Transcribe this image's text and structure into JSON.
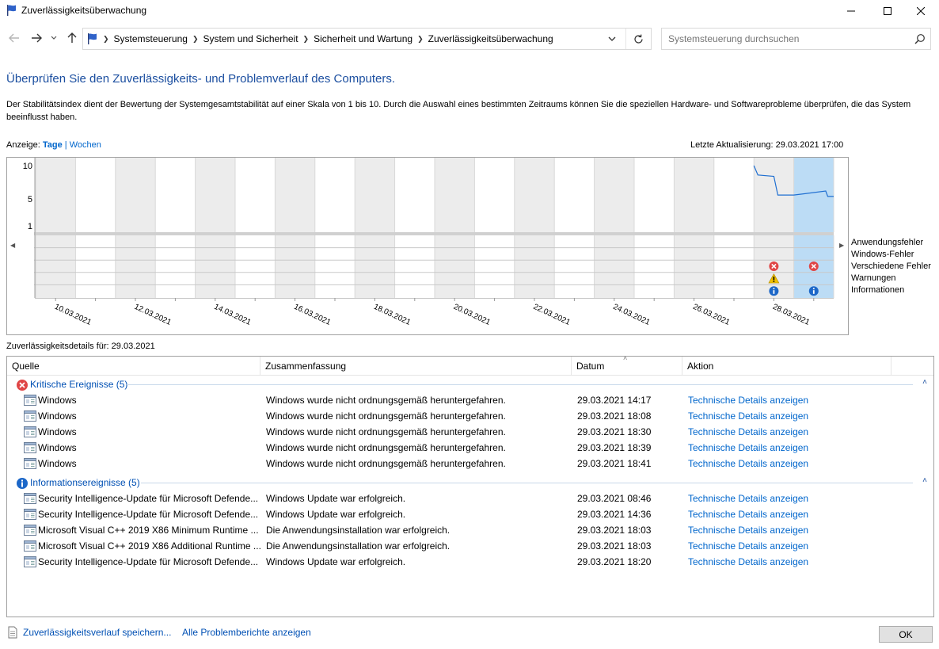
{
  "window": {
    "title": "Zuverlässigkeitsüberwachung"
  },
  "address": {
    "crumbs": [
      "Systemsteuerung",
      "System und Sicherheit",
      "Sicherheit und Wartung",
      "Zuverlässigkeitsüberwachung"
    ],
    "search_placeholder": "Systemsteuerung durchsuchen"
  },
  "header": {
    "title": "Überprüfen Sie den Zuverlässigkeits- und Problemverlauf des Computers.",
    "description": "Der Stabilitätsindex dient der Bewertung der Systemgesamtstabilität auf einer Skala von 1 bis 10. Durch die Auswahl eines bestimmten Zeitraums können Sie die speziellen Hardware- und Softwareprobleme überprüfen, die das System beeinflusst haben."
  },
  "view": {
    "label": "Anzeige:",
    "option_days": "Tage",
    "separator": "|",
    "option_weeks": "Wochen"
  },
  "last_update": "Letzte Aktualisierung: 29.03.2021 17:00",
  "chart_data": {
    "type": "line",
    "y_ticks": [
      "10",
      "5",
      "1"
    ],
    "ylim": [
      1,
      10
    ],
    "date_labels": [
      "10.03.2021",
      "12.03.2021",
      "14.03.2021",
      "16.03.2021",
      "18.03.2021",
      "20.03.2021",
      "22.03.2021",
      "24.03.2021",
      "26.03.2021",
      "28.03.2021"
    ],
    "column_count": 20,
    "selected_column": 19,
    "stability_series": [
      {
        "col": 18.0,
        "value": 10.0
      },
      {
        "col": 18.1,
        "value": 8.6
      },
      {
        "col": 18.5,
        "value": 8.4
      },
      {
        "col": 18.6,
        "value": 5.6
      },
      {
        "col": 19.0,
        "value": 5.6
      },
      {
        "col": 19.8,
        "value": 6.2
      },
      {
        "col": 19.85,
        "value": 5.4
      },
      {
        "col": 20.0,
        "value": 5.4
      }
    ],
    "event_rows": [
      "Anwendungsfehler",
      "Windows-Fehler",
      "Verschiedene Fehler",
      "Warnungen",
      "Informationen"
    ],
    "events": [
      {
        "col": 18,
        "row": 2,
        "kind": "error"
      },
      {
        "col": 18,
        "row": 3,
        "kind": "warning"
      },
      {
        "col": 18,
        "row": 4,
        "kind": "info"
      },
      {
        "col": 19,
        "row": 2,
        "kind": "error"
      },
      {
        "col": 19,
        "row": 4,
        "kind": "info"
      }
    ],
    "colors": {
      "line": "#1f6fd1",
      "selected": "#bcdcf5",
      "shaded": "#ececec",
      "error": "#e04646",
      "warning": "#f2c200",
      "info": "#1c67c8"
    }
  },
  "details": {
    "label": "Zuverlässigkeitsdetails für: 29.03.2021",
    "columns": [
      "Quelle",
      "Zusammenfassung",
      "Datum",
      "Aktion"
    ],
    "groups": [
      {
        "label": "Kritische Ereignisse (5)",
        "icon": "error-icon",
        "rows": [
          {
            "source": "Windows",
            "summary": "Windows wurde nicht ordnungsgemäß heruntergefahren.",
            "date": "29.03.2021 14:17",
            "action": "Technische Details anzeigen"
          },
          {
            "source": "Windows",
            "summary": "Windows wurde nicht ordnungsgemäß heruntergefahren.",
            "date": "29.03.2021 18:08",
            "action": "Technische Details anzeigen"
          },
          {
            "source": "Windows",
            "summary": "Windows wurde nicht ordnungsgemäß heruntergefahren.",
            "date": "29.03.2021 18:30",
            "action": "Technische Details anzeigen"
          },
          {
            "source": "Windows",
            "summary": "Windows wurde nicht ordnungsgemäß heruntergefahren.",
            "date": "29.03.2021 18:39",
            "action": "Technische Details anzeigen"
          },
          {
            "source": "Windows",
            "summary": "Windows wurde nicht ordnungsgemäß heruntergefahren.",
            "date": "29.03.2021 18:41",
            "action": "Technische Details anzeigen"
          }
        ]
      },
      {
        "label": "Informationsereignisse (5)",
        "icon": "info-icon",
        "rows": [
          {
            "source": "Security Intelligence-Update für Microsoft Defende...",
            "summary": "Windows Update war erfolgreich.",
            "date": "29.03.2021 08:46",
            "action": "Technische Details anzeigen"
          },
          {
            "source": "Security Intelligence-Update für Microsoft Defende...",
            "summary": "Windows Update war erfolgreich.",
            "date": "29.03.2021 14:36",
            "action": "Technische Details anzeigen"
          },
          {
            "source": "Microsoft Visual C++ 2019 X86 Minimum Runtime ...",
            "summary": "Die Anwendungsinstallation war erfolgreich.",
            "date": "29.03.2021 18:03",
            "action": "Technische Details anzeigen"
          },
          {
            "source": "Microsoft Visual C++ 2019 X86 Additional Runtime ...",
            "summary": "Die Anwendungsinstallation war erfolgreich.",
            "date": "29.03.2021 18:03",
            "action": "Technische Details anzeigen"
          },
          {
            "source": "Security Intelligence-Update für Microsoft Defende...",
            "summary": "Windows Update war erfolgreich.",
            "date": "29.03.2021 18:20",
            "action": "Technische Details anzeigen"
          }
        ]
      }
    ]
  },
  "footer": {
    "save_link": "Zuverlässigkeitsverlauf speichern...",
    "reports_link": "Alle Problemberichte anzeigen",
    "ok_label": "OK"
  }
}
